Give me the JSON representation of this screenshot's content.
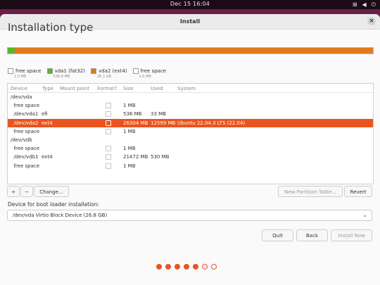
{
  "topbar": {
    "clock": "Dec 15  16:04",
    "icons": [
      "network-icon",
      "volume-icon",
      "power-icon"
    ]
  },
  "window": {
    "title": "Install"
  },
  "page": {
    "title": "Installation type"
  },
  "partition_bar": [
    {
      "name": "free-space-1",
      "color": "#e8e8e8",
      "fraction": 0.0
    },
    {
      "name": "vda1",
      "color": "#58b42a",
      "fraction": 0.02
    },
    {
      "name": "vda2",
      "color": "#e07a1a",
      "fraction": 0.98
    },
    {
      "name": "free-space-2",
      "color": "#e8e8e8",
      "fraction": 0.0
    }
  ],
  "legend": [
    {
      "label": "free space",
      "size": "1.0 MB",
      "color": "#ffffff"
    },
    {
      "label": "vda1 (fat32)",
      "size": "536.9 MB",
      "color": "#58b42a"
    },
    {
      "label": "vda2 (ext4)",
      "size": "26.3 GB",
      "color": "#e07a1a"
    },
    {
      "label": "free space",
      "size": "1.0 MB",
      "color": "#ffffff"
    }
  ],
  "table": {
    "headers": {
      "device": "Device",
      "type": "Type",
      "mount": "Mount point",
      "format": "Format?",
      "size": "Size",
      "used": "Used",
      "system": "System"
    },
    "rows": [
      {
        "device": "/dev/vda",
        "type": "",
        "format": false,
        "size": "",
        "used": "",
        "system": "",
        "selected": false
      },
      {
        "device": "  free space",
        "type": "",
        "format": true,
        "size": "1 MB",
        "used": "",
        "system": "",
        "selected": false
      },
      {
        "device": "  /dev/vda1",
        "type": "efi",
        "format": true,
        "size": "536 MB",
        "used": "33 MB",
        "system": "",
        "selected": false
      },
      {
        "device": "  /dev/vda2",
        "type": "ext4",
        "format": true,
        "size": "26304 MB",
        "used": "12599 MB",
        "system": "Ubuntu 22.04.3 LTS (22.04)",
        "selected": true
      },
      {
        "device": "  free space",
        "type": "",
        "format": true,
        "size": "1 MB",
        "used": "",
        "system": "",
        "selected": false
      },
      {
        "device": "/dev/vdb",
        "type": "",
        "format": false,
        "size": "",
        "used": "",
        "system": "",
        "selected": false
      },
      {
        "device": "  free space",
        "type": "",
        "format": true,
        "size": "1 MB",
        "used": "",
        "system": "",
        "selected": false
      },
      {
        "device": "  /dev/vdb1",
        "type": "ext4",
        "format": true,
        "size": "21472 MB",
        "used": "530 MB",
        "system": "",
        "selected": false
      },
      {
        "device": "  free space",
        "type": "",
        "format": true,
        "size": "1 MB",
        "used": "",
        "system": "",
        "selected": false
      }
    ]
  },
  "buttons": {
    "add": "+",
    "remove": "−",
    "change": "Change...",
    "new_table": "New Partition Table...",
    "revert": "Revert",
    "quit": "Quit",
    "back": "Back",
    "install": "Install Now"
  },
  "boot": {
    "label": "Device for boot loader installation:",
    "value": "/dev/vda   Virtio Block Device (26.8 GB)"
  },
  "progress": {
    "total_steps": 7,
    "completed_steps": 5
  },
  "colors": {
    "accent": "#e95420"
  }
}
